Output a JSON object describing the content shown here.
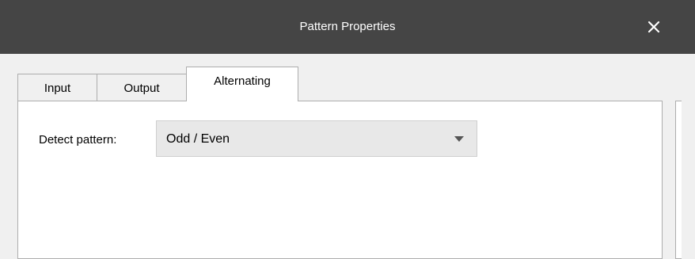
{
  "window": {
    "title": "Pattern Properties",
    "close_icon": "close-icon"
  },
  "tabs": [
    {
      "label": "Input",
      "active": false
    },
    {
      "label": "Output",
      "active": false
    },
    {
      "label": "Alternating",
      "active": true
    }
  ],
  "alternating": {
    "detect_label": "Detect pattern:",
    "detect_value": "Odd / Even",
    "dropdown_icon": "chevron-down-icon"
  },
  "colors": {
    "titlebar": "#454545",
    "panel": "#ffffff",
    "background": "#f0f0f0"
  }
}
